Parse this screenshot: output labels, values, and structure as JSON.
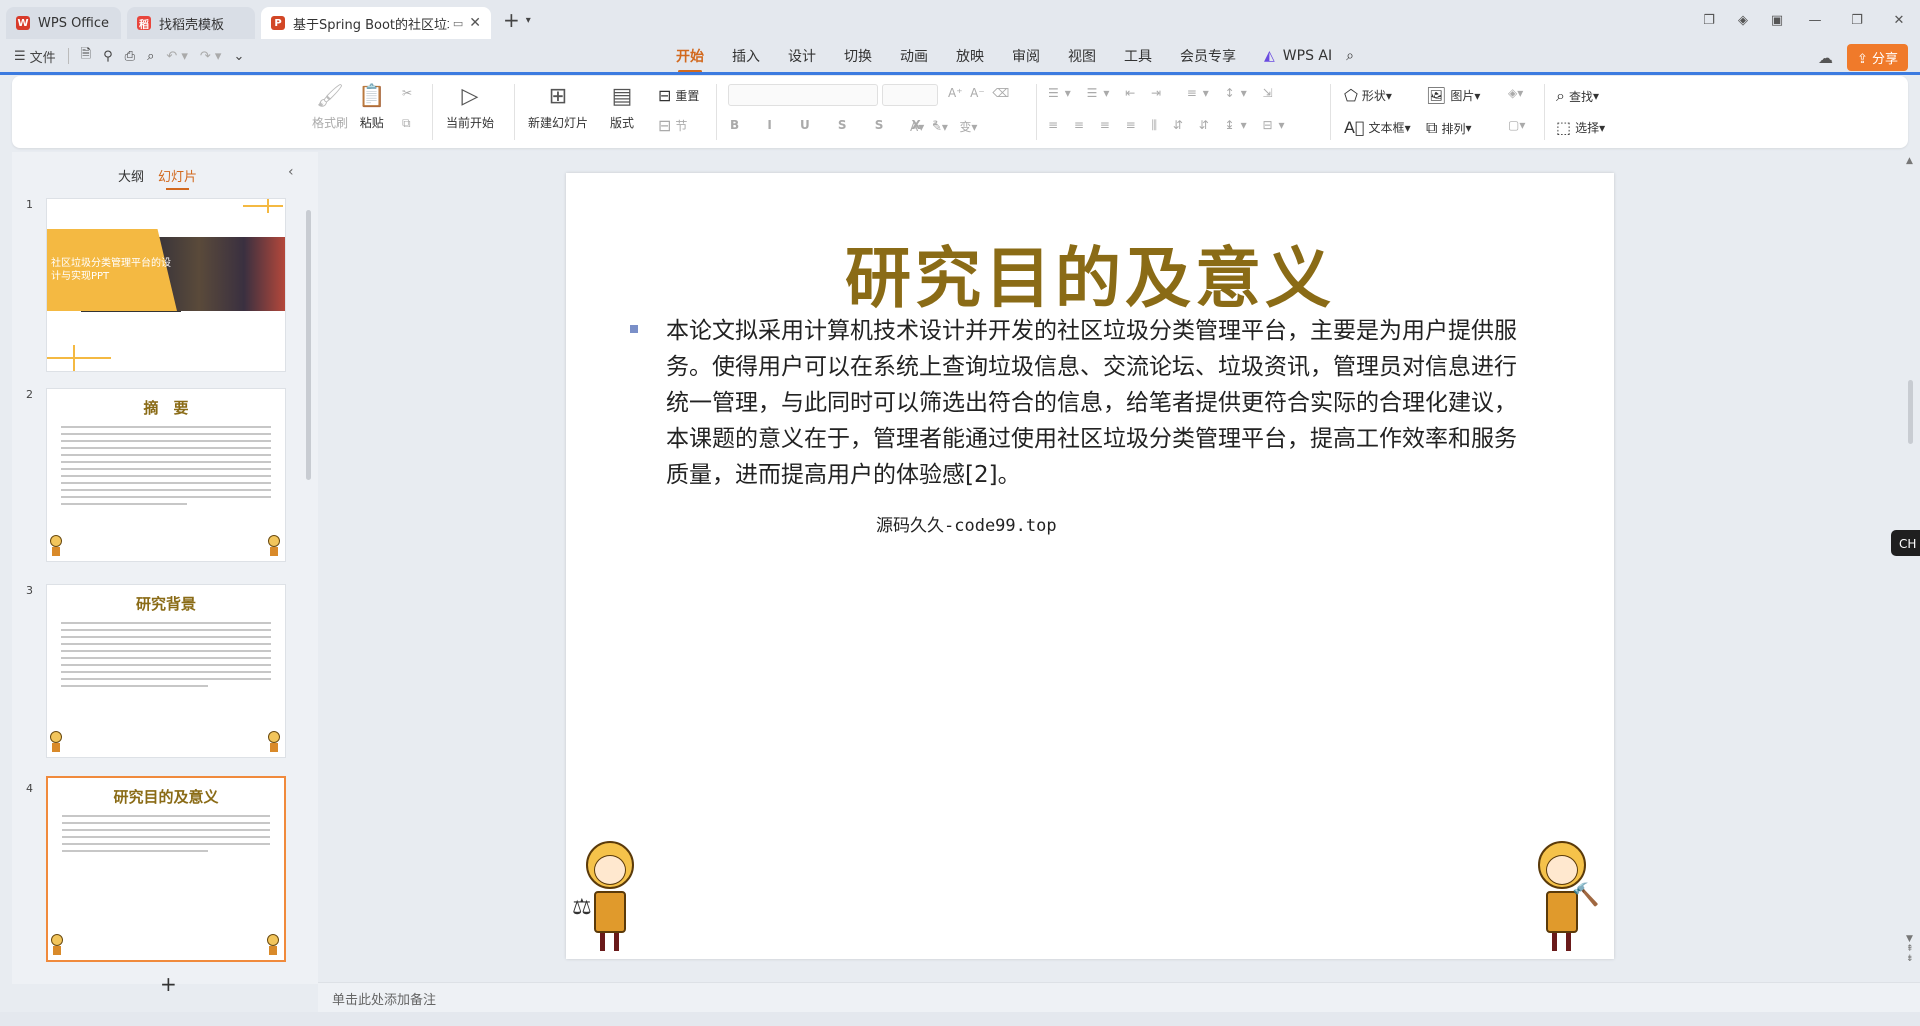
{
  "tabs": [
    {
      "label": "WPS Office",
      "color": "#d83b2b"
    },
    {
      "label": "找稻壳模板",
      "color": "#e8453c"
    },
    {
      "label": "基于Spring Boot的社区垃圾",
      "color": "#d24726"
    }
  ],
  "menu": {
    "file": "文件",
    "items": [
      "开始",
      "插入",
      "设计",
      "切换",
      "动画",
      "放映",
      "审阅",
      "视图",
      "工具",
      "会员专享"
    ],
    "active": "开始",
    "wps_ai": "WPS AI",
    "share": "分享"
  },
  "ribbon": {
    "format_painter": "格式刷",
    "paste": "粘贴",
    "start_from_current": "当前开始",
    "new_slide": "新建幻灯片",
    "layout": "版式",
    "reset": "重置",
    "section": "节",
    "shape": "形状",
    "picture": "图片",
    "textbox": "文本框",
    "arrange": "排列",
    "find": "查找",
    "select": "选择"
  },
  "left_panel": {
    "tab_outline": "大纲",
    "tab_slides": "幻灯片",
    "slides": [
      {
        "num": "1",
        "title": "社区垃圾分类管理平台的设计与实现PPT"
      },
      {
        "num": "2",
        "title": "摘　要"
      },
      {
        "num": "3",
        "title": "研究背景"
      },
      {
        "num": "4",
        "title": "研究目的及意义"
      }
    ],
    "add": "+"
  },
  "slide": {
    "title": "研究目的及意义",
    "body": "本论文拟采用计算机技术设计并开发的社区垃圾分类管理平台，主要是为用户提供服务。使得用户可以在系统上查询垃圾信息、交流论坛、垃圾资讯，管理员对信息进行统一管理，与此同时可以筛选出符合的信息，给笔者提供更符合实际的合理化建议，本课题的意义在于，管理者能通过使用社区垃圾分类管理平台，提高工作效率和服务质量，进而提高用户的体验感[2]。",
    "note": "源码久久-code99.top",
    "title_color": "#8a6b16"
  },
  "notes_placeholder": "单击此处添加备注",
  "ime": "CH ◗ 简"
}
